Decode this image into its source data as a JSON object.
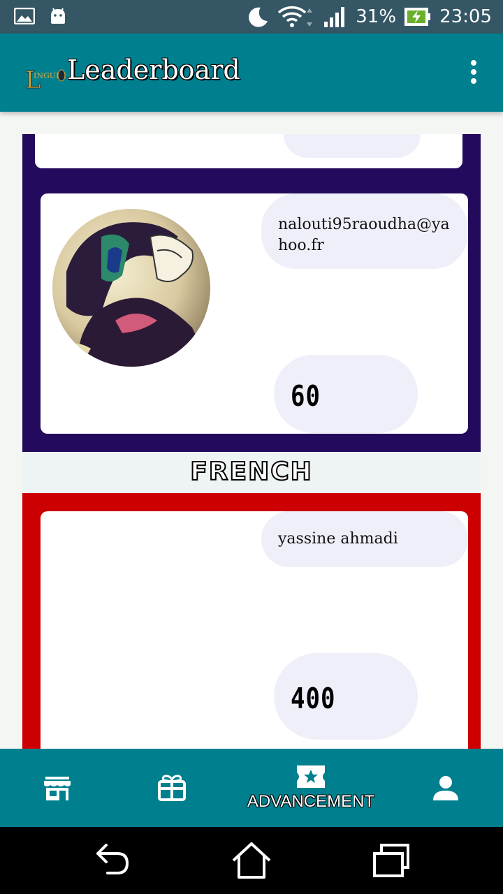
{
  "status_bar": {
    "battery": "31%",
    "time": "23:05",
    "icons": [
      "image-icon",
      "android-icon",
      "moon-icon",
      "wifi-icon",
      "signal-icon",
      "battery-charging-icon"
    ]
  },
  "toolbar": {
    "logo_text": "LINGUED",
    "title": "Leaderboard"
  },
  "leaderboard": {
    "sections": [
      {
        "color": "#230a5c",
        "entries": [
          {
            "name": "nalouti95raoudha@yahoo.fr",
            "score": "60"
          }
        ]
      },
      {
        "language": "FRENCH",
        "color": "#cc0000",
        "entries": [
          {
            "name": "yassine ahmadi",
            "score": "400"
          }
        ]
      }
    ]
  },
  "bottom_nav": {
    "items": [
      {
        "icon": "store-icon",
        "label": ""
      },
      {
        "icon": "gift-icon",
        "label": ""
      },
      {
        "icon": "ticket-star-icon",
        "label": "ADVANCEMENT",
        "selected": true
      },
      {
        "icon": "person-icon",
        "label": ""
      }
    ]
  },
  "colors": {
    "primary": "#00808f",
    "status_bar": "#355664",
    "pill": "#efeff9"
  }
}
